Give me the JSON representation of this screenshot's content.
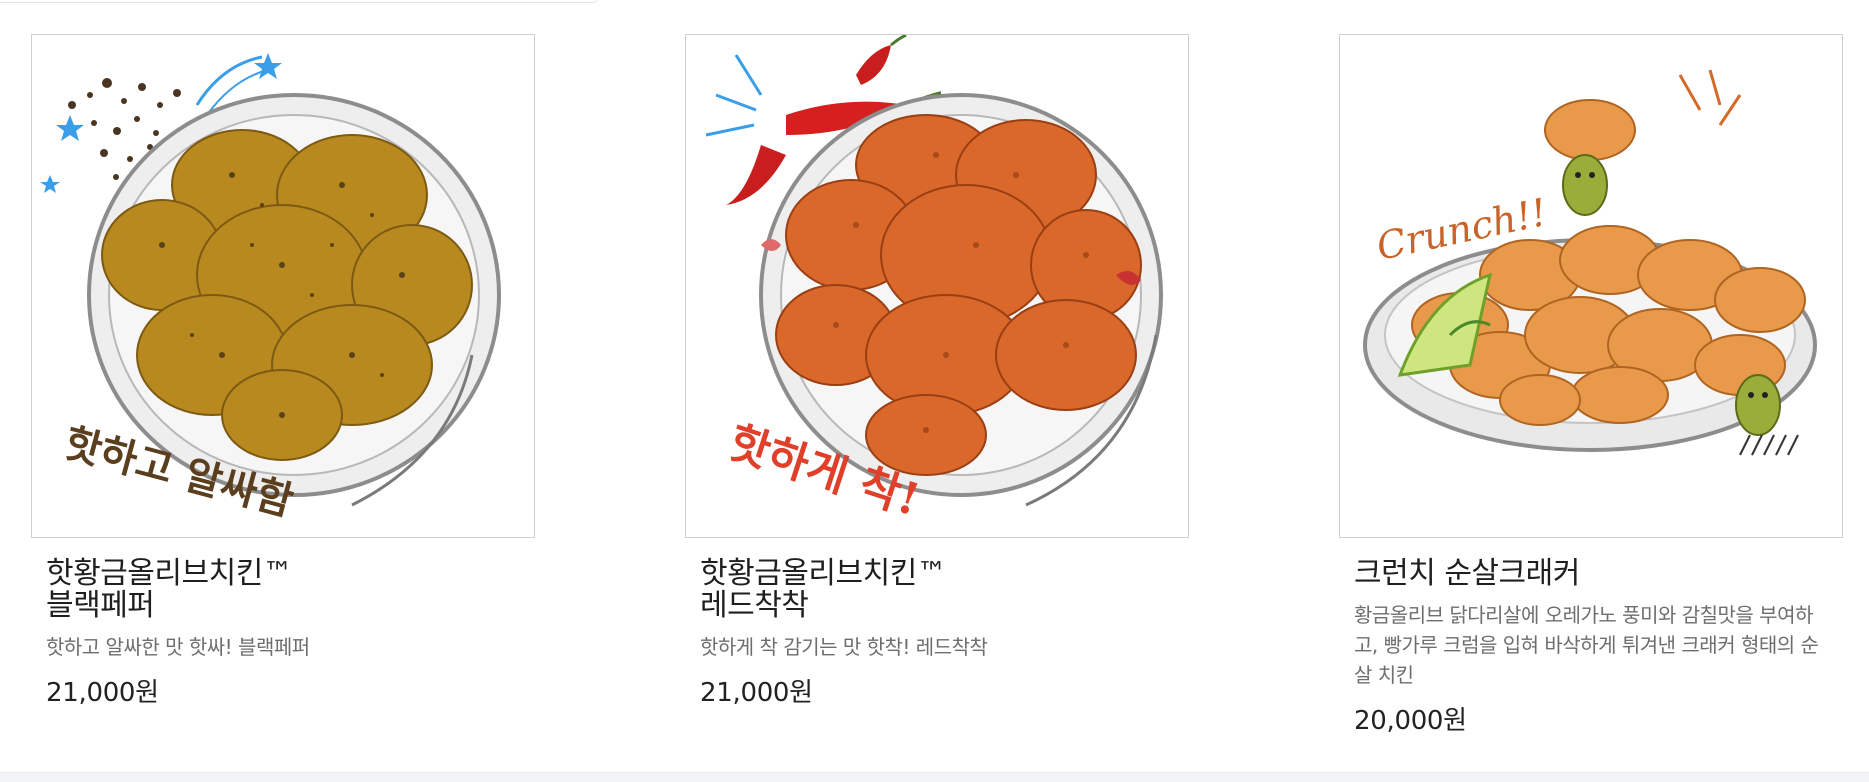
{
  "products": [
    {
      "name": "핫황금올리브치킨™\n블랙페퍼",
      "description": "핫하고 알싸한 맛 핫싸! 블랙페퍼",
      "price": "21,000원",
      "image_text": "핫하고 알싸함",
      "image_icon": "black-pepper-chicken-plate"
    },
    {
      "name": "핫황금올리브치킨™\n레드착착",
      "description": "핫하게 착 감기는 맛 핫착! 레드착착",
      "price": "21,000원",
      "image_text": "핫하게 착!",
      "image_icon": "red-pepper-chicken-plate"
    },
    {
      "name": "크런치 순살크래커",
      "description": "황금올리브 닭다리살에 오레가노 풍미와 감칠맛을 부여하고, 빵가루 크럼을 입혀 바삭하게 튀겨낸 크래커 형태의 순살 치킨",
      "price": "20,000원",
      "image_text": "Crunch!!",
      "image_icon": "boneless-cracker-chicken-plate"
    }
  ],
  "colors": {
    "black_pepper_chicken": "#b8891f",
    "red_chicken": "#d9682a",
    "cracker_chicken": "#e89a4a",
    "plate_rim": "#8d8d8d"
  }
}
